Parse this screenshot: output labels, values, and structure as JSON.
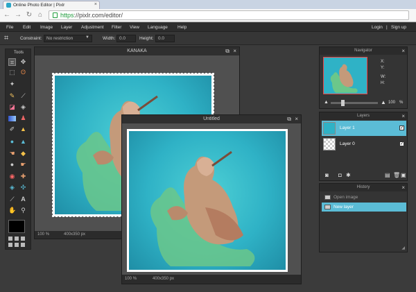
{
  "browser": {
    "tab_title": "Online Photo Editor | Pixlr",
    "url_https": "https",
    "url_rest": "://pixlr.com/editor/"
  },
  "menu": {
    "items": [
      "File",
      "Edit",
      "Image",
      "Layer",
      "Adjustment",
      "Filter",
      "View",
      "Language",
      "Help"
    ],
    "login": "Login",
    "separator": "|",
    "signup": "Sign up"
  },
  "options": {
    "constraint_label": "Constraint:",
    "constraint_value": "No restriction",
    "width_label": "Width:",
    "width_value": "0.0",
    "height_label": "Height:",
    "height_value": "0.0"
  },
  "toolbox": {
    "title": "Tools",
    "tools": [
      "crop-tool",
      "move-tool",
      "marquee-tool",
      "lasso-tool",
      "wand-tool",
      "pencil-tool",
      "brush-tool",
      "eraser-tool",
      "bucket-tool",
      "gradient-tool",
      "clone-tool",
      "color-replace-tool",
      "drawing-tool",
      "blur-tool",
      "sharpen-tool",
      "smudge-tool",
      "sponge-tool",
      "dodge-tool",
      "burn-tool",
      "red-eye-tool",
      "spot-heal-tool",
      "bloat-tool",
      "pinch-tool",
      "color-picker-tool",
      "type-tool",
      "hand-tool",
      "zoom-tool"
    ]
  },
  "windows": {
    "back": {
      "title": "KANAKA",
      "zoom": "100",
      "zoom_unit": "%",
      "size": "400x350 px"
    },
    "front": {
      "title": "Untitled",
      "zoom": "100",
      "zoom_unit": "%",
      "size": "400x350 px"
    }
  },
  "navigator": {
    "title": "Navigator",
    "x": "X:",
    "y": "Y:",
    "w": "W:",
    "h": "H:",
    "zoom": "100",
    "zoom_unit": "%"
  },
  "layers": {
    "title": "Layers",
    "items": [
      {
        "name": "Layer 1",
        "selected": true
      },
      {
        "name": "Layer 0",
        "selected": false
      }
    ]
  },
  "history": {
    "title": "History",
    "items": [
      {
        "name": "Open image",
        "selected": false
      },
      {
        "name": "New layer",
        "selected": true
      }
    ]
  },
  "colors": {
    "accent": "#5bbcd6",
    "panel": "#343434",
    "background": "#3b3b3b"
  }
}
